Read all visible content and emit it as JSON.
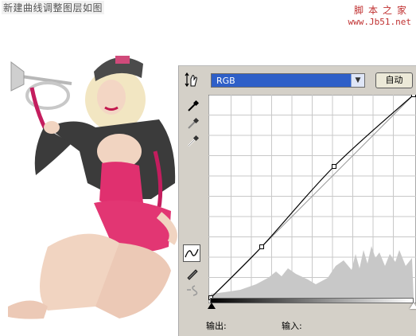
{
  "caption": "新建曲线调整图层如图",
  "watermark": {
    "line1": "脚本之家",
    "line2": "www.Jb51.net"
  },
  "curves": {
    "channel": "RGB",
    "auto_label": "自动",
    "output_label": "输出:",
    "input_label": "输入:",
    "points": [
      [
        0,
        0
      ],
      [
        64,
        64
      ],
      [
        155,
        165
      ],
      [
        255,
        255
      ]
    ]
  },
  "icons": [
    "adjust-channel-icon",
    "black-eyedropper-icon",
    "gray-eyedropper-icon",
    "white-eyedropper-icon",
    "curve-tool-icon",
    "pencil-icon",
    "smooth-icon",
    "chevron-down-icon"
  ],
  "colors": {
    "select_bg": "#2e5fc8",
    "panel_bg": "#d4d0c8",
    "watermark": "#c03030"
  }
}
